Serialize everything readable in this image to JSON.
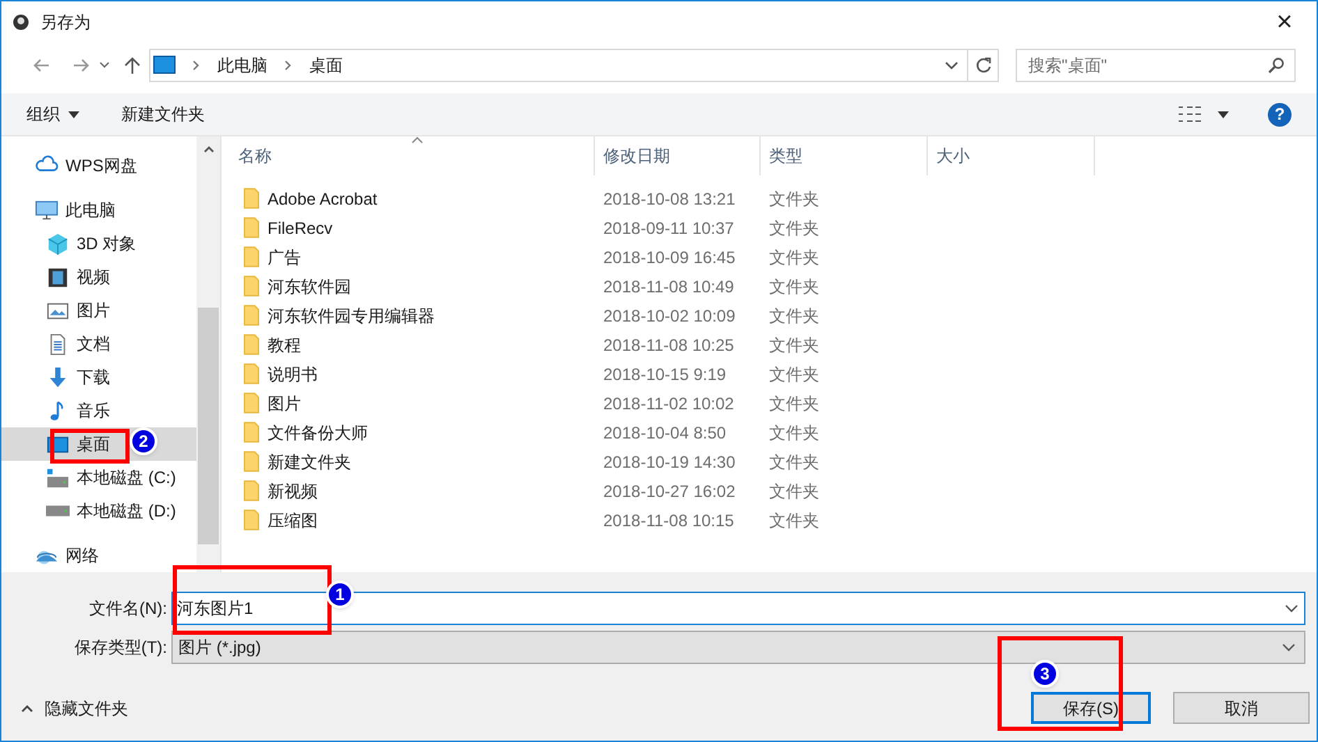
{
  "window": {
    "title": "另存为",
    "close": "×"
  },
  "address": {
    "crumbs": [
      "此电脑",
      "桌面"
    ],
    "search_placeholder": "搜索\"桌面\""
  },
  "toolbar": {
    "organize": "组织",
    "new_folder": "新建文件夹",
    "help": "?"
  },
  "sidebar": {
    "items": [
      {
        "label": "WPS网盘",
        "selected": false
      },
      {
        "label": "此电脑",
        "selected": false,
        "children": [
          {
            "label": "3D 对象",
            "selected": false
          },
          {
            "label": "视频",
            "selected": false
          },
          {
            "label": "图片",
            "selected": false
          },
          {
            "label": "文档",
            "selected": false
          },
          {
            "label": "下载",
            "selected": false
          },
          {
            "label": "音乐",
            "selected": false
          },
          {
            "label": "桌面",
            "selected": true
          },
          {
            "label": "本地磁盘 (C:)",
            "selected": false
          },
          {
            "label": "本地磁盘 (D:)",
            "selected": false
          }
        ]
      },
      {
        "label": "网络",
        "selected": false
      }
    ]
  },
  "table": {
    "columns": [
      "名称",
      "修改日期",
      "类型",
      "大小"
    ],
    "rows": [
      {
        "name": "Adobe Acrobat",
        "modified": "2018-10-08 13:21",
        "type": "文件夹"
      },
      {
        "name": "FileRecv",
        "modified": "2018-09-11 10:37",
        "type": "文件夹"
      },
      {
        "name": "广告",
        "modified": "2018-10-09 16:45",
        "type": "文件夹"
      },
      {
        "name": "河东软件园",
        "modified": "2018-11-08 10:49",
        "type": "文件夹"
      },
      {
        "name": "河东软件园专用编辑器",
        "modified": "2018-10-02 10:09",
        "type": "文件夹"
      },
      {
        "name": "教程",
        "modified": "2018-11-08 10:25",
        "type": "文件夹"
      },
      {
        "name": "说明书",
        "modified": "2018-10-15 9:19",
        "type": "文件夹"
      },
      {
        "name": "图片",
        "modified": "2018-11-02 10:02",
        "type": "文件夹"
      },
      {
        "name": "文件备份大师",
        "modified": "2018-10-04 8:50",
        "type": "文件夹"
      },
      {
        "name": "新建文件夹",
        "modified": "2018-10-19 14:30",
        "type": "文件夹"
      },
      {
        "name": "新视频",
        "modified": "2018-10-27 16:02",
        "type": "文件夹"
      },
      {
        "name": "压缩图",
        "modified": "2018-11-08 10:15",
        "type": "文件夹"
      }
    ]
  },
  "form": {
    "filename_label": "文件名(N):",
    "filename": "河东图片1",
    "type_label": "保存类型(T):",
    "type_value": "图片 (*.jpg)"
  },
  "hide_folders": "隐藏文件夹",
  "buttons": [
    {
      "label": "保存(S)",
      "default": true
    },
    {
      "label": "取消",
      "default": false
    }
  ],
  "annotations": [
    {
      "label": "1"
    },
    {
      "label": "2"
    },
    {
      "label": "3"
    }
  ]
}
